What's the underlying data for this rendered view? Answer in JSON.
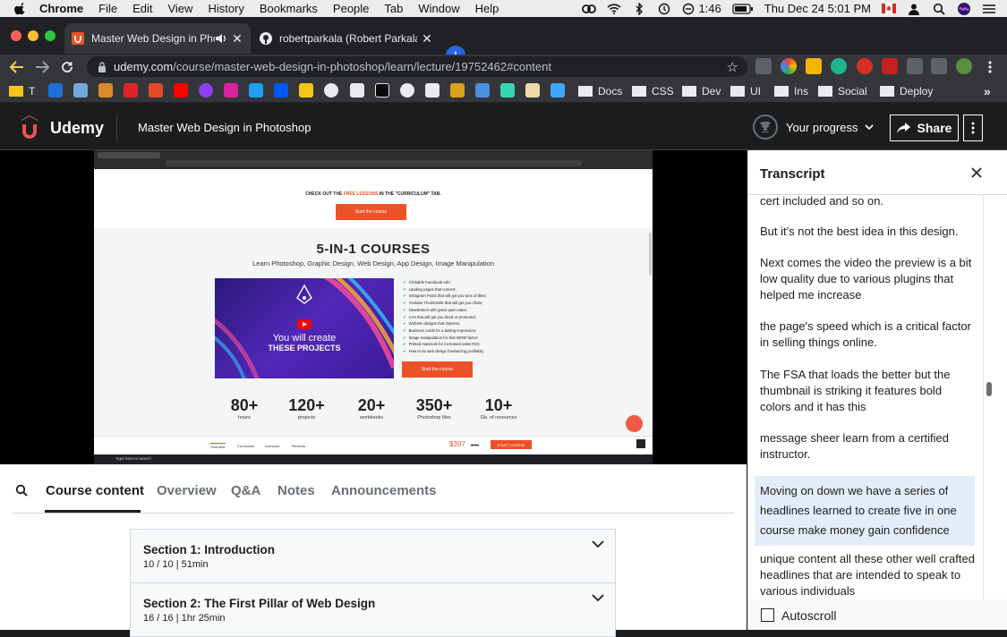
{
  "menubar": {
    "app": "Chrome",
    "items": [
      "File",
      "Edit",
      "View",
      "History",
      "Bookmarks",
      "People",
      "Tab",
      "Window",
      "Help"
    ],
    "time_small": "1:46",
    "datetime": "Thu Dec 24  5:01 PM"
  },
  "tabs": [
    {
      "title": "Master Web Design in Phot",
      "active": true
    },
    {
      "title": "robertparkala (Robert Parkala)",
      "active": false
    }
  ],
  "address": {
    "host": "udemy.com",
    "path": "/course/master-web-design-in-photoshop/learn/lecture/19752462#content"
  },
  "bookmarks": {
    "first_letter": "T",
    "folders": [
      "Docs",
      "CSS",
      "Dev",
      "UI",
      "Ins",
      "Social",
      "Deploy"
    ],
    "overflow": "»"
  },
  "header": {
    "logo_text": "Udemy",
    "course_title": "Master Web Design in Photoshop",
    "progress_label": "Your progress",
    "share_label": "Share"
  },
  "video": {
    "checkout_pre": "CHECK OUT THE ",
    "checkout_hl": "FREE LESSONS",
    "checkout_post": " IN THE \"CURRICULUM\" TAB.",
    "start_btn": "Start the course",
    "headline": "5-IN-1 COURSES",
    "subheadline": "Learn Photoshop, Graphic Design, Web Design, App Design, Image Manipulation",
    "image_line1": "You will create",
    "image_line2": "THESE PROJECTS",
    "features": [
      "Clickable Facebook Ads;",
      "Landing pages that convert;",
      "Instagram Posts that will get you tons of likes;",
      "Youtube Thumbnails that will get you clicks;",
      "Newsletters with great open-rates;",
      "CVs that will get you hired or promoted;",
      "Website designs that impress;",
      "Business cards for a lasting impression;",
      "Image manipulation for that WOW factor;",
      "Printed materials for increased sales ROI;",
      "How to do web design freelancing profitably;"
    ],
    "start_btn2": "Start the course",
    "stats": [
      {
        "num": "80+",
        "label": "hours"
      },
      {
        "num": "120+",
        "label": "projects"
      },
      {
        "num": "20+",
        "label": "workbooks"
      },
      {
        "num": "350+",
        "label": "Photoshop files"
      },
      {
        "num": "10+",
        "label": "Gb. of resources"
      }
    ],
    "bottom_nav": [
      "Overview",
      "Curriculum",
      "Instructor",
      "Reviews"
    ],
    "price": "$397",
    "old_price": "$799",
    "start_small": "START COURSE",
    "taskbar_search": "Type here to search"
  },
  "lower_tabs": [
    "Course content",
    "Overview",
    "Q&A",
    "Notes",
    "Announcements"
  ],
  "sections": [
    {
      "title": "Section 1: Introduction",
      "meta": "10 / 10 | 51min"
    },
    {
      "title": "Section 2: The First Pillar of Web Design",
      "meta": "16 / 16 | 1hr 25min"
    }
  ],
  "transcript": {
    "title": "Transcript",
    "cues": [
      {
        "text": "cert included and so on.",
        "active": false
      },
      {
        "text": "But it's not the best idea in this design.",
        "active": false
      },
      {
        "text": "Next comes the video the preview is a bit low quality due to various plugins that helped me increase",
        "active": false
      },
      {
        "text": "the page's speed which is a critical factor in selling things online.",
        "active": false
      },
      {
        "text": "The FSA that loads the better but the thumbnail is striking it features bold colors and it has this",
        "active": false
      },
      {
        "text": "message sheer learn from a certified instructor.",
        "active": false
      },
      {
        "text": "Moving on down we have a series of headlines learned to create five in one course make money gain confidence",
        "active": true
      },
      {
        "text": "unique content all these other well crafted headlines that are intended to speak to various individuals",
        "active": false
      }
    ],
    "autoscroll_label": "Autoscroll",
    "autoscroll_checked": false
  },
  "colors": {
    "udemy_dark": "#1c1d1f",
    "udemy_red": "#a435f0",
    "accent_orange": "#ec5228",
    "cue_highlight": "#e4ecf9"
  }
}
